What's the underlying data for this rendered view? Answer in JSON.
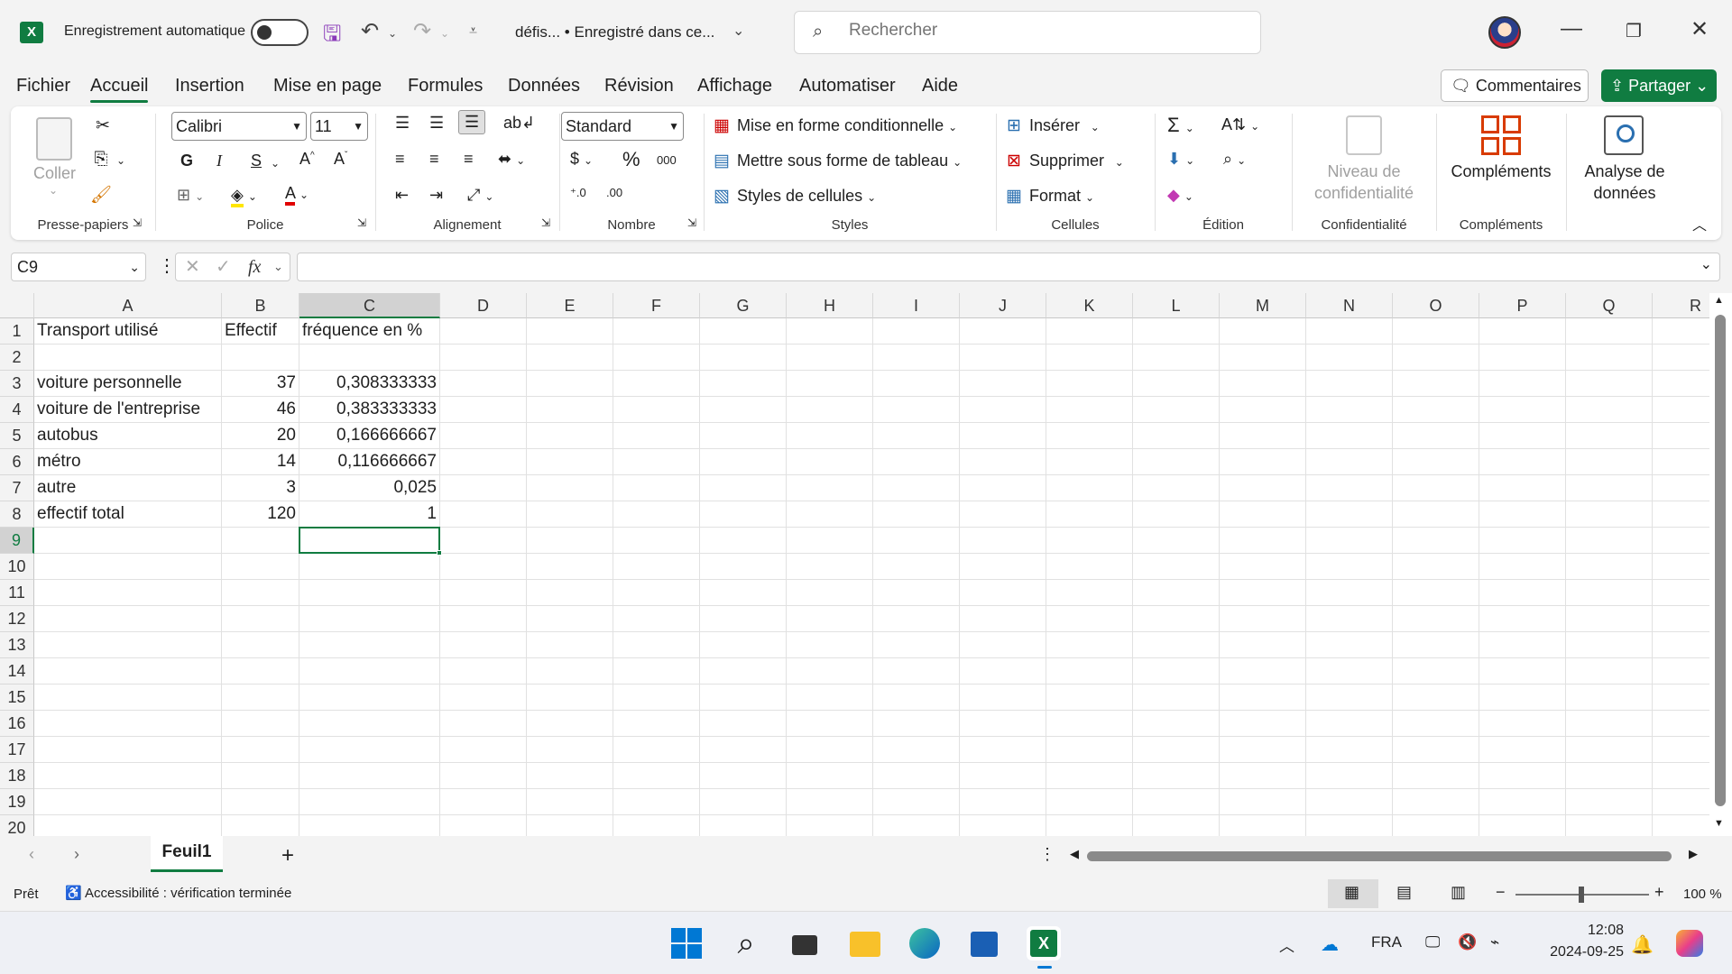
{
  "titlebar": {
    "app_icon": "X",
    "autosave_label": "Enregistrement automatique",
    "doc_title": "défis...  •  Enregistré dans ce...",
    "search_placeholder": "Rechercher"
  },
  "menu": {
    "tabs": [
      "Fichier",
      "Accueil",
      "Insertion",
      "Mise en page",
      "Formules",
      "Données",
      "Révision",
      "Affichage",
      "Automatiser",
      "Aide"
    ],
    "active": "Accueil",
    "comments_label": "Commentaires",
    "share_label": "Partager"
  },
  "ribbon": {
    "clipboard": {
      "paste_label": "Coller",
      "group_label": "Presse-papiers"
    },
    "font": {
      "font_name": "Calibri",
      "font_size": "11",
      "bold": "G",
      "italic": "I",
      "underline": "S",
      "group_label": "Police"
    },
    "alignment": {
      "group_label": "Alignment",
      "group_label_fr": "Alignement"
    },
    "number": {
      "format": "Standard",
      "group_label": "Nombre"
    },
    "styles": {
      "conditional": "Mise en forme conditionnelle",
      "as_table": "Mettre sous forme de tableau",
      "cell_styles": "Styles de cellules",
      "group_label": "Styles"
    },
    "cells": {
      "insert": "Insérer",
      "delete": "Supprimer",
      "format": "Format",
      "group_label": "Cellules"
    },
    "editing": {
      "group_label": "Édition"
    },
    "sensitivity": {
      "label_line1": "Niveau de",
      "label_line2": "confidentialité",
      "group_label": "Confidentialité"
    },
    "addins": {
      "label": "Compléments",
      "group_label": "Compléments"
    },
    "analyze": {
      "label_line1": "Analyse de",
      "label_line2": "données"
    }
  },
  "formula_bar": {
    "name_box": "C9",
    "fx": "fx",
    "formula": ""
  },
  "grid": {
    "columns": [
      "A",
      "B",
      "C",
      "D",
      "E",
      "F",
      "G",
      "H",
      "I",
      "J",
      "K",
      "L",
      "M",
      "N",
      "O",
      "P",
      "Q",
      "R"
    ],
    "rows": [
      "1",
      "2",
      "3",
      "4",
      "5",
      "6",
      "7",
      "8",
      "9",
      "10",
      "11",
      "12",
      "13",
      "14",
      "15",
      "16",
      "17",
      "18",
      "19",
      "20"
    ],
    "selected_col": "C",
    "selected_row": "9",
    "data": [
      {
        "row": 1,
        "A": "Transport utilisé",
        "B": "Effectif",
        "C": "fréquence en %"
      },
      {
        "row": 3,
        "A": "voiture personnelle",
        "B": "37",
        "C": "0,308333333"
      },
      {
        "row": 4,
        "A": "voiture de l'entreprise",
        "B": "46",
        "C": "0,383333333"
      },
      {
        "row": 5,
        "A": "autobus",
        "B": "20",
        "C": "0,166666667"
      },
      {
        "row": 6,
        "A": "métro",
        "B": "14",
        "C": "0,116666667"
      },
      {
        "row": 7,
        "A": "autre",
        "B": "3",
        "C": "0,025"
      },
      {
        "row": 8,
        "A": "effectif total",
        "B": "120",
        "C": "1"
      }
    ]
  },
  "sheets": {
    "tabs": [
      "Feuil1"
    ],
    "add": "+"
  },
  "status": {
    "ready": "Prêt",
    "accessibility": "Accessibilité : vérification terminée",
    "zoom": "100 %"
  },
  "taskbar": {
    "lang": "FRA",
    "time": "12:08",
    "date": "2024-09-25"
  },
  "colors": {
    "accent": "#107c41"
  }
}
